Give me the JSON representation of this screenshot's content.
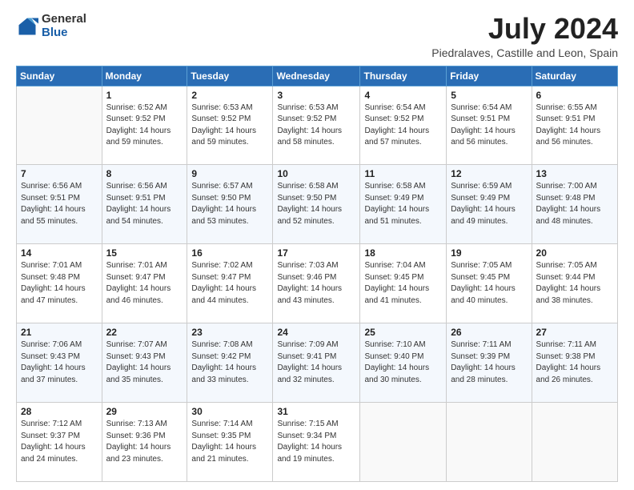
{
  "logo": {
    "general": "General",
    "blue": "Blue"
  },
  "title": {
    "month": "July 2024",
    "location": "Piedralaves, Castille and Leon, Spain"
  },
  "weekdays": [
    "Sunday",
    "Monday",
    "Tuesday",
    "Wednesday",
    "Thursday",
    "Friday",
    "Saturday"
  ],
  "weeks": [
    [
      {
        "day": "",
        "info": ""
      },
      {
        "day": "1",
        "info": "Sunrise: 6:52 AM\nSunset: 9:52 PM\nDaylight: 14 hours\nand 59 minutes."
      },
      {
        "day": "2",
        "info": "Sunrise: 6:53 AM\nSunset: 9:52 PM\nDaylight: 14 hours\nand 59 minutes."
      },
      {
        "day": "3",
        "info": "Sunrise: 6:53 AM\nSunset: 9:52 PM\nDaylight: 14 hours\nand 58 minutes."
      },
      {
        "day": "4",
        "info": "Sunrise: 6:54 AM\nSunset: 9:52 PM\nDaylight: 14 hours\nand 57 minutes."
      },
      {
        "day": "5",
        "info": "Sunrise: 6:54 AM\nSunset: 9:51 PM\nDaylight: 14 hours\nand 56 minutes."
      },
      {
        "day": "6",
        "info": "Sunrise: 6:55 AM\nSunset: 9:51 PM\nDaylight: 14 hours\nand 56 minutes."
      }
    ],
    [
      {
        "day": "7",
        "info": "Sunrise: 6:56 AM\nSunset: 9:51 PM\nDaylight: 14 hours\nand 55 minutes."
      },
      {
        "day": "8",
        "info": "Sunrise: 6:56 AM\nSunset: 9:51 PM\nDaylight: 14 hours\nand 54 minutes."
      },
      {
        "day": "9",
        "info": "Sunrise: 6:57 AM\nSunset: 9:50 PM\nDaylight: 14 hours\nand 53 minutes."
      },
      {
        "day": "10",
        "info": "Sunrise: 6:58 AM\nSunset: 9:50 PM\nDaylight: 14 hours\nand 52 minutes."
      },
      {
        "day": "11",
        "info": "Sunrise: 6:58 AM\nSunset: 9:49 PM\nDaylight: 14 hours\nand 51 minutes."
      },
      {
        "day": "12",
        "info": "Sunrise: 6:59 AM\nSunset: 9:49 PM\nDaylight: 14 hours\nand 49 minutes."
      },
      {
        "day": "13",
        "info": "Sunrise: 7:00 AM\nSunset: 9:48 PM\nDaylight: 14 hours\nand 48 minutes."
      }
    ],
    [
      {
        "day": "14",
        "info": "Sunrise: 7:01 AM\nSunset: 9:48 PM\nDaylight: 14 hours\nand 47 minutes."
      },
      {
        "day": "15",
        "info": "Sunrise: 7:01 AM\nSunset: 9:47 PM\nDaylight: 14 hours\nand 46 minutes."
      },
      {
        "day": "16",
        "info": "Sunrise: 7:02 AM\nSunset: 9:47 PM\nDaylight: 14 hours\nand 44 minutes."
      },
      {
        "day": "17",
        "info": "Sunrise: 7:03 AM\nSunset: 9:46 PM\nDaylight: 14 hours\nand 43 minutes."
      },
      {
        "day": "18",
        "info": "Sunrise: 7:04 AM\nSunset: 9:45 PM\nDaylight: 14 hours\nand 41 minutes."
      },
      {
        "day": "19",
        "info": "Sunrise: 7:05 AM\nSunset: 9:45 PM\nDaylight: 14 hours\nand 40 minutes."
      },
      {
        "day": "20",
        "info": "Sunrise: 7:05 AM\nSunset: 9:44 PM\nDaylight: 14 hours\nand 38 minutes."
      }
    ],
    [
      {
        "day": "21",
        "info": "Sunrise: 7:06 AM\nSunset: 9:43 PM\nDaylight: 14 hours\nand 37 minutes."
      },
      {
        "day": "22",
        "info": "Sunrise: 7:07 AM\nSunset: 9:43 PM\nDaylight: 14 hours\nand 35 minutes."
      },
      {
        "day": "23",
        "info": "Sunrise: 7:08 AM\nSunset: 9:42 PM\nDaylight: 14 hours\nand 33 minutes."
      },
      {
        "day": "24",
        "info": "Sunrise: 7:09 AM\nSunset: 9:41 PM\nDaylight: 14 hours\nand 32 minutes."
      },
      {
        "day": "25",
        "info": "Sunrise: 7:10 AM\nSunset: 9:40 PM\nDaylight: 14 hours\nand 30 minutes."
      },
      {
        "day": "26",
        "info": "Sunrise: 7:11 AM\nSunset: 9:39 PM\nDaylight: 14 hours\nand 28 minutes."
      },
      {
        "day": "27",
        "info": "Sunrise: 7:11 AM\nSunset: 9:38 PM\nDaylight: 14 hours\nand 26 minutes."
      }
    ],
    [
      {
        "day": "28",
        "info": "Sunrise: 7:12 AM\nSunset: 9:37 PM\nDaylight: 14 hours\nand 24 minutes."
      },
      {
        "day": "29",
        "info": "Sunrise: 7:13 AM\nSunset: 9:36 PM\nDaylight: 14 hours\nand 23 minutes."
      },
      {
        "day": "30",
        "info": "Sunrise: 7:14 AM\nSunset: 9:35 PM\nDaylight: 14 hours\nand 21 minutes."
      },
      {
        "day": "31",
        "info": "Sunrise: 7:15 AM\nSunset: 9:34 PM\nDaylight: 14 hours\nand 19 minutes."
      },
      {
        "day": "",
        "info": ""
      },
      {
        "day": "",
        "info": ""
      },
      {
        "day": "",
        "info": ""
      }
    ]
  ]
}
